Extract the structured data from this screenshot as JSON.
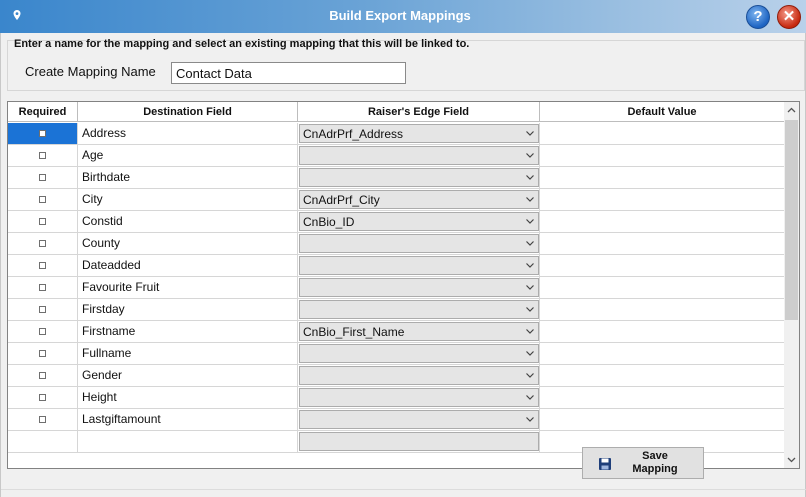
{
  "window": {
    "title": "Build Export Mappings",
    "help_label": "?",
    "close_label": "✕"
  },
  "form": {
    "instruction": "Enter a name for the mapping and select an existing mapping that this will be linked to.",
    "mapping_name_label": "Create Mapping Name",
    "mapping_name_value": "Contact Data"
  },
  "grid": {
    "columns": [
      "Required",
      "Destination Field",
      "Raiser's Edge Field",
      "Default Value"
    ],
    "rows": [
      {
        "destination": "Address",
        "raisers_edge": "CnAdrPrf_Address",
        "default": "",
        "required": false,
        "selected": true
      },
      {
        "destination": "Age",
        "raisers_edge": "",
        "default": "",
        "required": false
      },
      {
        "destination": "Birthdate",
        "raisers_edge": "",
        "default": "",
        "required": false
      },
      {
        "destination": "City",
        "raisers_edge": "CnAdrPrf_City",
        "default": "",
        "required": false
      },
      {
        "destination": "Constid",
        "raisers_edge": "CnBio_ID",
        "default": "",
        "required": false
      },
      {
        "destination": "County",
        "raisers_edge": "",
        "default": "",
        "required": false
      },
      {
        "destination": "Dateadded",
        "raisers_edge": "",
        "default": "",
        "required": false
      },
      {
        "destination": "Favourite Fruit",
        "raisers_edge": "",
        "default": "",
        "required": false
      },
      {
        "destination": "Firstday",
        "raisers_edge": "",
        "default": "",
        "required": false
      },
      {
        "destination": "Firstname",
        "raisers_edge": "CnBio_First_Name",
        "default": "",
        "required": false
      },
      {
        "destination": "Fullname",
        "raisers_edge": "",
        "default": "",
        "required": false
      },
      {
        "destination": "Gender",
        "raisers_edge": "",
        "default": "",
        "required": false
      },
      {
        "destination": "Height",
        "raisers_edge": "",
        "default": "",
        "required": false
      },
      {
        "destination": "Lastgiftamount",
        "raisers_edge": "",
        "default": "",
        "required": false
      }
    ]
  },
  "buttons": {
    "save_line1": "Save",
    "save_line2": "Mapping"
  },
  "colors": {
    "selected_row": "#1b73d6",
    "titlebar_start": "#3a86cc"
  },
  "icons": {
    "title": "pin-icon",
    "help": "help-icon",
    "close": "close-icon",
    "save": "floppy-disk-icon",
    "dropdown": "chevron-down-icon"
  }
}
